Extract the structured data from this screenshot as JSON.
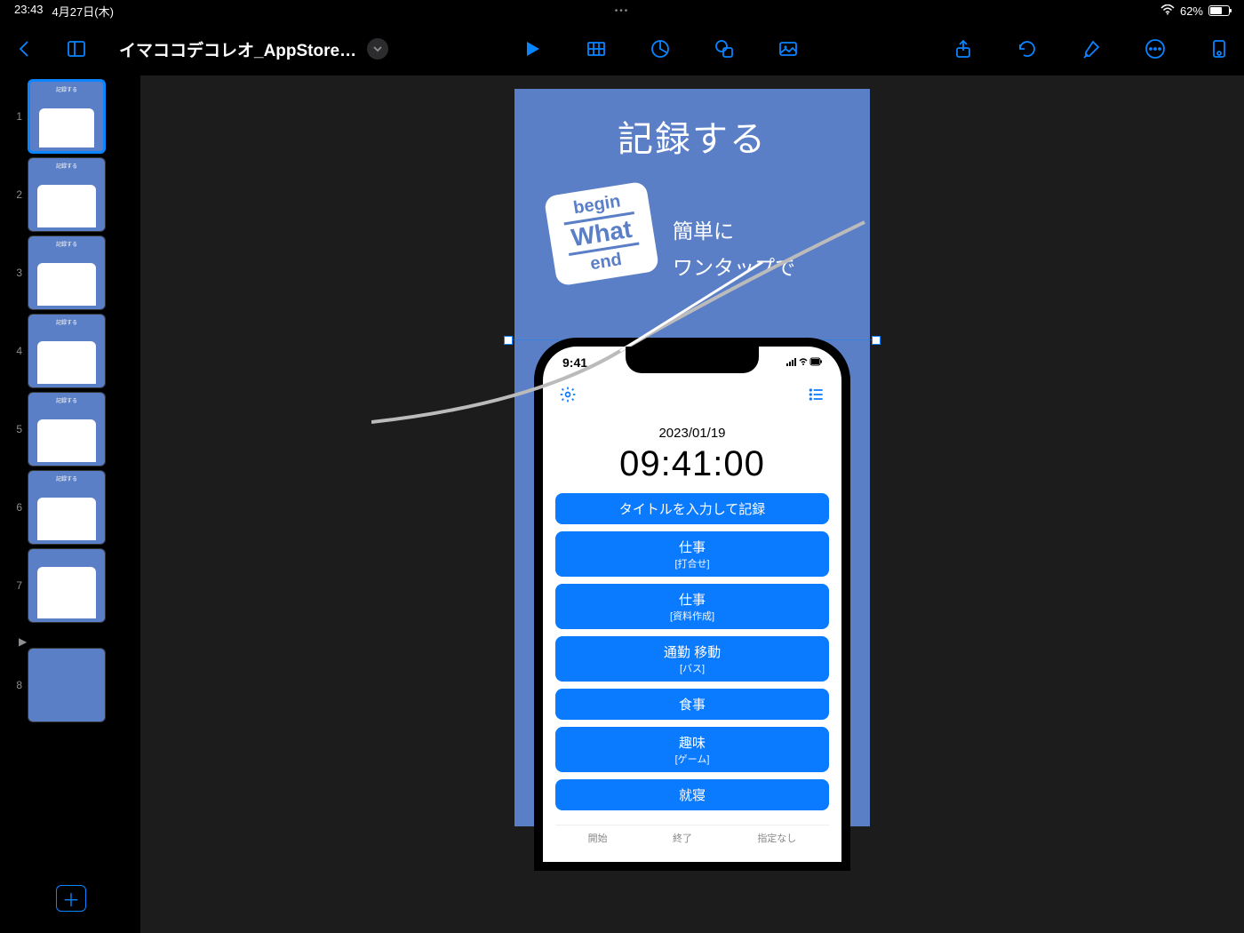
{
  "statusbar": {
    "time": "23:43",
    "date": "4月27日(木)",
    "dots": "•••",
    "battery_pct": "62%"
  },
  "toolbar": {
    "title": "イマココデコレオ_AppStore…"
  },
  "slides": {
    "count": 8,
    "nums": [
      "1",
      "2",
      "3",
      "4",
      "5",
      "6",
      "7",
      "8"
    ]
  },
  "slideContent": {
    "heading": "記録する",
    "logo": {
      "l1": "begin",
      "l2": "What",
      "l3": "end"
    },
    "tagline_l1": "簡単に",
    "tagline_l2": "ワンタップで",
    "phone": {
      "status_time": "9:41",
      "date": "2023/01/19",
      "time": "09:41:00",
      "primary_btn": "タイトルを入力して記録",
      "items": [
        {
          "t": "仕事",
          "s": "[打合せ]"
        },
        {
          "t": "仕事",
          "s": "[資料作成]"
        },
        {
          "t": "通勤 移動",
          "s": "[バス]"
        },
        {
          "t": "食事",
          "s": ""
        },
        {
          "t": "趣味",
          "s": "[ゲーム]"
        },
        {
          "t": "就寝",
          "s": ""
        }
      ],
      "tabs": [
        "開始",
        "終了",
        "指定なし"
      ]
    }
  }
}
